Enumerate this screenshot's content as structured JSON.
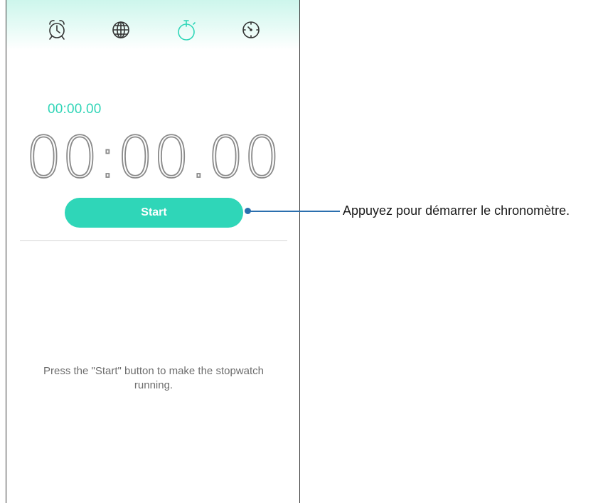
{
  "tabs": [
    {
      "id": "alarm",
      "icon": "alarm-clock-icon",
      "active": false
    },
    {
      "id": "world-clock",
      "icon": "globe-icon",
      "active": false
    },
    {
      "id": "stopwatch",
      "icon": "stopwatch-icon",
      "active": true
    },
    {
      "id": "timer",
      "icon": "timer-icon",
      "active": false
    }
  ],
  "stopwatch": {
    "lap_time": "00:00.00",
    "main_time": "00:00.00",
    "start_label": "Start",
    "hint": "Press the \"Start\" button to make the stopwatch running."
  },
  "callout": {
    "text": "Appuyez pour démarrer le chronomètre."
  },
  "colors": {
    "accent": "#2fd6b8",
    "icon_inactive": "#333333",
    "callout": "#2a6fae"
  }
}
